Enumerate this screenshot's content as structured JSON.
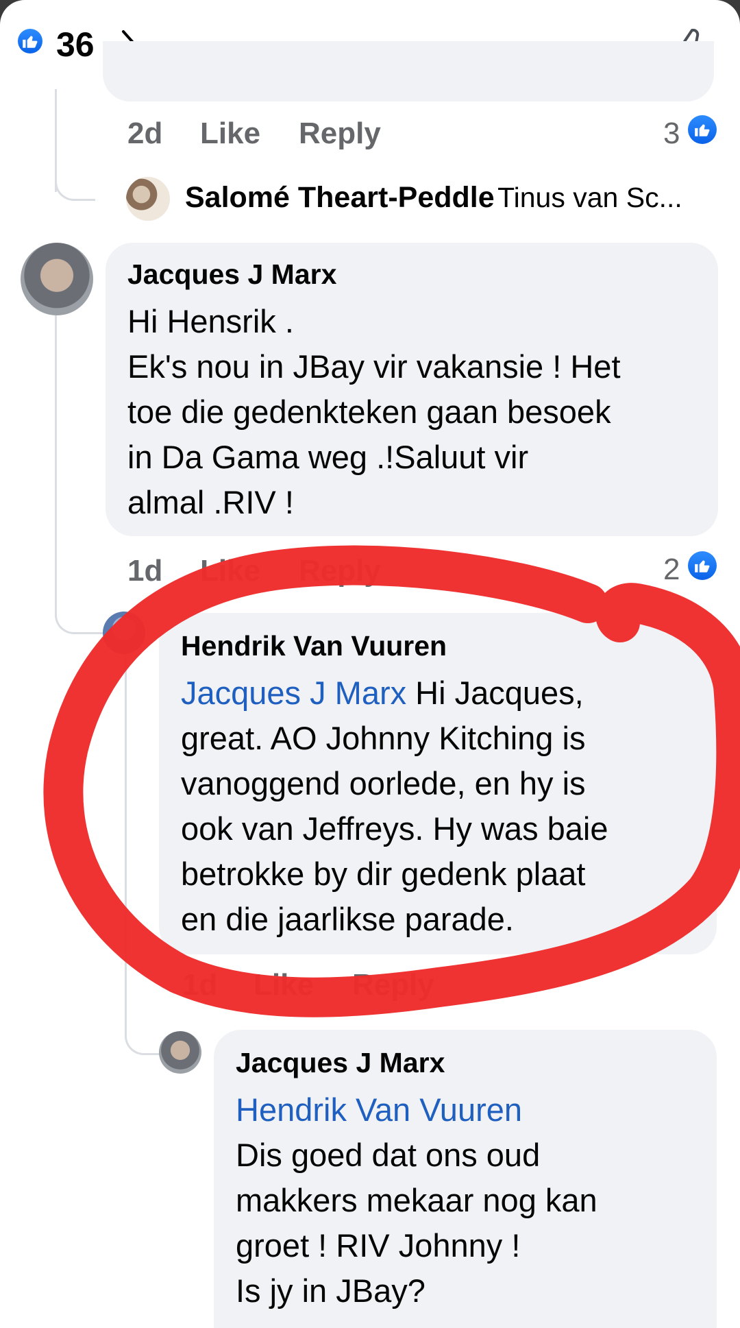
{
  "header": {
    "like_count": "36",
    "icons": [
      "like-icon",
      "chevron-right-icon",
      "thumbs-up-outline-icon"
    ]
  },
  "comments": [
    {
      "time": "2d",
      "like_label": "Like",
      "reply_label": "Reply",
      "reaction_count": "3",
      "collapsed_reply": {
        "author": "Salomé Theart-Peddle",
        "preview": "Tinus van Sc..."
      }
    },
    {
      "author": "Jacques J Marx",
      "lines": [
        "Hi Hensrik .",
        "Ek's nou in JBay vir vakansie ! Het",
        "toe die gedenkteken gaan besoek",
        "in Da Gama weg .!Saluut vir",
        "almal .RIV !"
      ],
      "time": "1d",
      "like_label": "Like",
      "reply_label": "Reply",
      "reaction_count": "2"
    },
    {
      "author": "Hendrik Van Vuuren",
      "mention": "Jacques J Marx",
      "first_line_rest": " Hi Jacques,",
      "lines": [
        "great. AO Johnny Kitching is",
        "vanoggend oorlede, en hy is",
        "ook van Jeffreys. Hy was baie",
        "betrokke by dir gedenk plaat",
        "en die jaarlikse parade."
      ],
      "time": "1d",
      "like_label": "Like",
      "reply_label": "Reply"
    },
    {
      "author": "Jacques J Marx",
      "mention": "Hendrik Van Vuuren",
      "lines": [
        "Dis goed dat ons oud",
        "makkers mekaar nog kan",
        "groet ! RIV Johnny !",
        "Is jy in JBay?"
      ]
    }
  ],
  "colors": {
    "like_blue": "#1877f2",
    "mention_blue": "#1f5fbf",
    "bubble_bg": "#f0f2f5",
    "meta_gray": "#65676b",
    "annotation_red": "#ee2b2b"
  }
}
